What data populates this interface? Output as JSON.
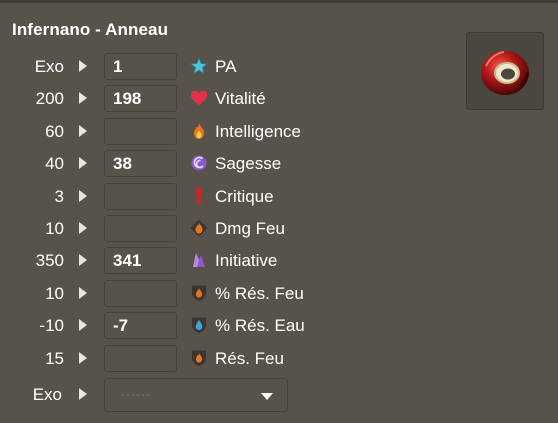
{
  "title": "Infernano - Anneau",
  "stats": [
    {
      "base": "Exo",
      "value": "1",
      "label": "PA",
      "icon": "pa-star-icon"
    },
    {
      "base": "200",
      "value": "198",
      "label": "Vitalité",
      "icon": "vitality-heart-icon"
    },
    {
      "base": "60",
      "value": "",
      "label": "Intelligence",
      "icon": "intelligence-flame-icon"
    },
    {
      "base": "40",
      "value": "38",
      "label": "Sagesse",
      "icon": "wisdom-swirl-icon"
    },
    {
      "base": "3",
      "value": "",
      "label": "Critique",
      "icon": "critical-exclamation-icon"
    },
    {
      "base": "10",
      "value": "",
      "label": "Dmg Feu",
      "icon": "fire-damage-icon"
    },
    {
      "base": "350",
      "value": "341",
      "label": "Initiative",
      "icon": "initiative-icon"
    },
    {
      "base": "10",
      "value": "",
      "label": "% Rés. Feu",
      "icon": "fire-resistance-percent-icon"
    },
    {
      "base": "-10",
      "value": "-7",
      "label": "% Rés. Eau",
      "icon": "water-resistance-percent-icon"
    },
    {
      "base": "15",
      "value": "",
      "label": "Rés. Feu",
      "icon": "fire-resistance-icon"
    }
  ],
  "exo_row": {
    "label": "Exo",
    "placeholder": "------"
  },
  "colors": {
    "background": "#58534a",
    "pa": "#4fc3d9",
    "vitality": "#e0304a",
    "fire": "#e8751d",
    "wisdom": "#8a5cc9",
    "critical": "#d8201c",
    "water": "#3fa3d6",
    "ring": "#b01818"
  }
}
